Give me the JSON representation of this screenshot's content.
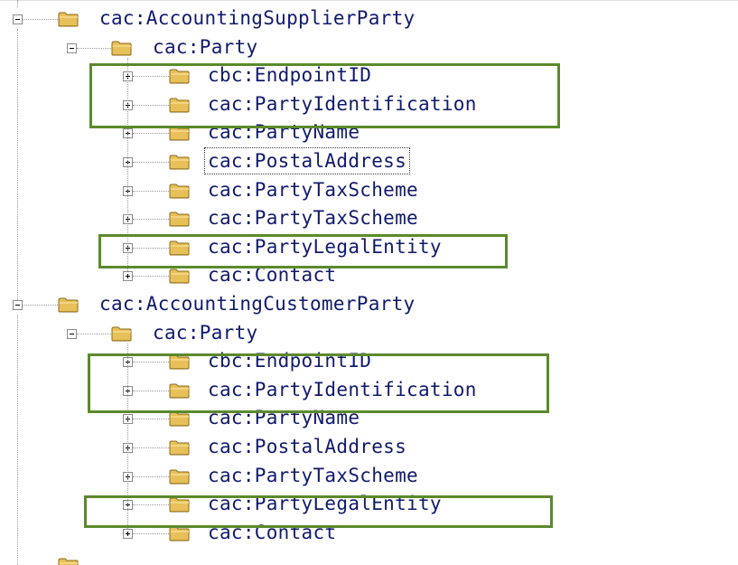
{
  "tree": {
    "supplier": {
      "label": "cac:AccountingSupplierParty",
      "party": {
        "label": "cac:Party",
        "children": [
          "cbc:EndpointID",
          "cac:PartyIdentification",
          "cac:PartyName",
          "cac:PostalAddress",
          "cac:PartyTaxScheme",
          "cac:PartyTaxScheme",
          "cac:PartyLegalEntity",
          "cac:Contact"
        ]
      }
    },
    "customer": {
      "label": "cac:AccountingCustomerParty",
      "party": {
        "label": "cac:Party",
        "children": [
          "cbc:EndpointID",
          "cac:PartyIdentification",
          "cac:PartyName",
          "cac:PostalAddress",
          "cac:PartyTaxScheme",
          "cac:PartyLegalEntity",
          "cac:Contact"
        ]
      }
    },
    "highlight_color": "#5b8a2c",
    "text_color": "#111a6b",
    "folder_icon": "folder-icon"
  }
}
